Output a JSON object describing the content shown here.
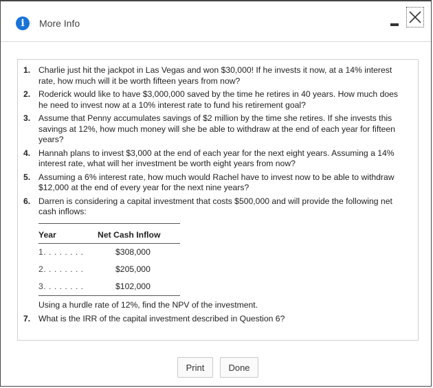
{
  "window": {
    "title": "More Info",
    "icon": "info-icon",
    "accent": "#1a73d9"
  },
  "questions": [
    {
      "num": "1.",
      "text": "Charlie just hit the jackpot in Las Vegas and won $30,000! If he invests it now, at a 14% interest rate, how much will it be worth fifteen years from now?"
    },
    {
      "num": "2.",
      "text": "Roderick would like to have $3,000,000 saved by the time he retires in 40 years. How much does he need to invest now at a 10% interest rate to fund his retirement goal?"
    },
    {
      "num": "3.",
      "text": "Assume that Penny accumulates savings of $2 million by the time she retires. If she invests this savings at 12%, how much money will she be able to withdraw at the end of each year for fifteen years?"
    },
    {
      "num": "4.",
      "text": "Hannah plans to invest $3,000 at the end of each year for the next eight years. Assuming a 14% interest rate, what will her investment be worth eight years from now?"
    },
    {
      "num": "5.",
      "text": "Assuming a 6% interest rate, how much would Rachel have to invest now to be able to withdraw $12,000 at the end of every year for the next nine years?"
    },
    {
      "num": "6.",
      "text": "Darren is considering a capital investment that costs $500,000 and will provide the following net cash inflows:",
      "after": "Using a hurdle rate of 12%, find the NPV of the investment."
    },
    {
      "num": "7.",
      "text": "What is the IRR of the capital investment described in Question 6?"
    }
  ],
  "cash_table": {
    "headers": {
      "year": "Year",
      "inflow": "Net Cash Inflow"
    },
    "rows": [
      {
        "year": "1. . . . . . . .",
        "inflow": "$308,000"
      },
      {
        "year": "2. . . . . . . .",
        "inflow": "$205,000"
      },
      {
        "year": "3. . . . . . . .",
        "inflow": "$102,000"
      }
    ]
  },
  "buttons": {
    "print": "Print",
    "done": "Done"
  }
}
